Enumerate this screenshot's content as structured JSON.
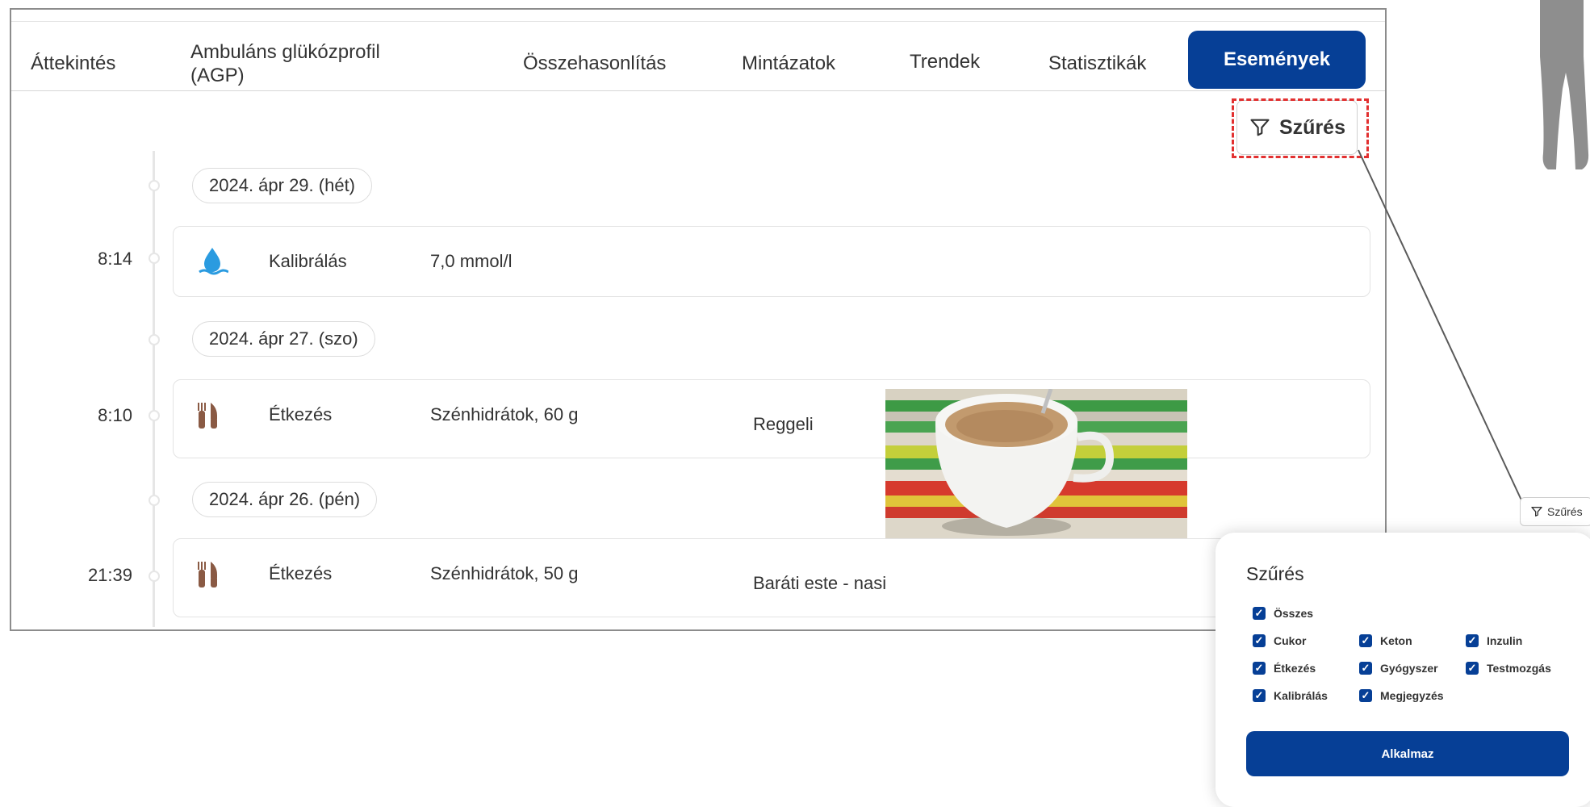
{
  "tabs": [
    {
      "label": "Áttekintés"
    },
    {
      "label": "Ambuláns glükózprofil (AGP)"
    },
    {
      "label": "Összehasonlítás"
    },
    {
      "label": "Mintázatok"
    },
    {
      "label": "Trendek"
    },
    {
      "label": "Statisztikák"
    },
    {
      "label": "Események",
      "active": true
    }
  ],
  "filter_button": {
    "label": "Szűrés"
  },
  "days": [
    {
      "date": "2024. ápr 29. (hét)",
      "event": {
        "time": "8:14",
        "icon": "water-drop-icon",
        "type": "Kalibrálás",
        "value": "7,0 mmol/l",
        "note": ""
      }
    },
    {
      "date": "2024. ápr 27. (szo)",
      "event": {
        "time": "8:10",
        "icon": "fork-knife-icon",
        "type": "Étkezés",
        "value": "Szénhidrátok, 60 g",
        "note": "Reggeli"
      }
    },
    {
      "date": "2024. ápr 26. (pén)",
      "event": {
        "time": "21:39",
        "icon": "fork-knife-icon",
        "type": "Étkezés",
        "value": "Szénhidrátok, 50 g",
        "note": "Baráti este - nasi"
      }
    }
  ],
  "mini_filter": {
    "label": "Szűrés"
  },
  "filter_sheet": {
    "title": "Szűrés",
    "options": [
      {
        "label": "Összes",
        "checked": true
      },
      {
        "label": "Cukor",
        "checked": true
      },
      {
        "label": "Keton",
        "checked": true
      },
      {
        "label": "Inzulin",
        "checked": true
      },
      {
        "label": "Étkezés",
        "checked": true
      },
      {
        "label": "Gyógyszer",
        "checked": true
      },
      {
        "label": "Testmozgás",
        "checked": true
      },
      {
        "label": "Kalibrálás",
        "checked": true
      },
      {
        "label": "Megjegyzés",
        "checked": true
      }
    ],
    "apply_label": "Alkalmaz"
  },
  "colors": {
    "accent": "#063f96",
    "highlight": "#e23030",
    "drop": "#2a9be0",
    "utensil": "#8a5a44"
  }
}
